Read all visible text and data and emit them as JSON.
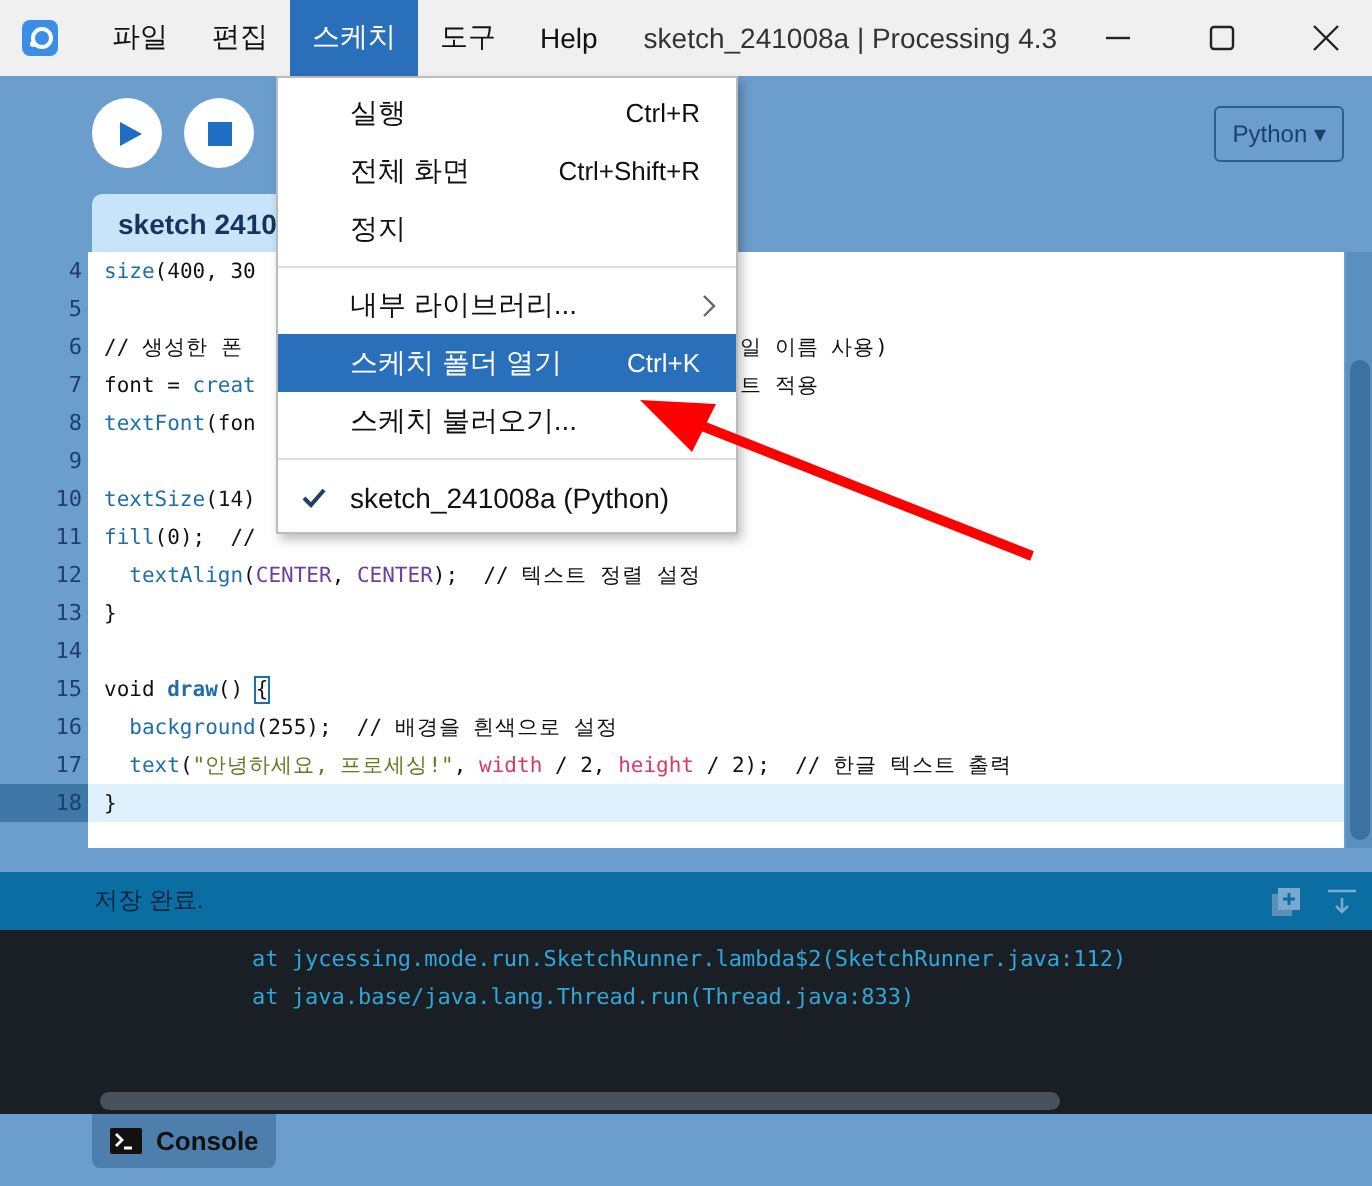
{
  "menubar": [
    {
      "label": "파일",
      "selected": false
    },
    {
      "label": "편집",
      "selected": false
    },
    {
      "label": "스케치",
      "selected": true
    },
    {
      "label": "도구",
      "selected": false
    },
    {
      "label": "Help",
      "selected": false
    }
  ],
  "window": {
    "title": "sketch_241008a | Processing 4.3"
  },
  "mode_selector": {
    "label": "Python ▾"
  },
  "tab": {
    "label": "sketch 2410"
  },
  "code_lines": [
    {
      "number": "4",
      "current": false,
      "tokens": [
        {
          "kind": "fn",
          "text": "size"
        },
        {
          "kind": "plain",
          "text": "(400, 30"
        }
      ]
    },
    {
      "number": "5",
      "current": false
    },
    {
      "number": "6",
      "current": false,
      "tokens": [
        {
          "kind": "plain",
          "text": "// 생성한 폰"
        }
      ],
      "tail": "일 이름 사용)"
    },
    {
      "number": "7",
      "current": false,
      "tokens": [
        {
          "kind": "plain",
          "text": "font = "
        },
        {
          "kind": "fn",
          "text": "creat"
        }
      ],
      "tail": "트 적용"
    },
    {
      "number": "8",
      "current": false,
      "tokens": [
        {
          "kind": "fn",
          "text": "textFont"
        },
        {
          "kind": "plain",
          "text": "(fon"
        }
      ]
    },
    {
      "number": "9",
      "current": false
    },
    {
      "number": "10",
      "current": false,
      "tokens": [
        {
          "kind": "fn",
          "text": "textSize"
        },
        {
          "kind": "plain",
          "text": "(14)"
        }
      ]
    },
    {
      "number": "11",
      "current": false,
      "tokens": [
        {
          "kind": "fn",
          "text": "fill"
        },
        {
          "kind": "plain",
          "text": "(0);  //"
        }
      ]
    },
    {
      "number": "12",
      "current": false,
      "tokens": [
        {
          "kind": "fn",
          "text": "  textAlign"
        },
        {
          "kind": "plain",
          "text": "("
        },
        {
          "kind": "const",
          "text": "CENTER"
        },
        {
          "kind": "plain",
          "text": ", "
        },
        {
          "kind": "const",
          "text": "CENTER"
        },
        {
          "kind": "plain",
          "text": ");  // 텍스트 정렬 설정"
        }
      ]
    },
    {
      "number": "13",
      "current": false,
      "tokens": [
        {
          "kind": "plain",
          "text": "}"
        }
      ]
    },
    {
      "number": "14",
      "current": false
    },
    {
      "number": "15",
      "current": false,
      "tokens": [
        {
          "kind": "plain",
          "text": "void "
        },
        {
          "kind": "fnbold",
          "text": "draw"
        },
        {
          "kind": "plain",
          "text": "() "
        },
        {
          "kind": "match",
          "text": "{"
        }
      ]
    },
    {
      "number": "16",
      "current": false,
      "tokens": [
        {
          "kind": "fn",
          "text": "  background"
        },
        {
          "kind": "plain",
          "text": "(255);  // 배경을 흰색으로 설정"
        }
      ]
    },
    {
      "number": "17",
      "current": false,
      "tokens": [
        {
          "kind": "fn",
          "text": "  text"
        },
        {
          "kind": "plain",
          "text": "("
        },
        {
          "kind": "string",
          "text": "\"안녕하세요, 프로세싱!\""
        },
        {
          "kind": "plain",
          "text": ", "
        },
        {
          "kind": "var",
          "text": "width"
        },
        {
          "kind": "plain",
          "text": " / 2, "
        },
        {
          "kind": "var",
          "text": "height"
        },
        {
          "kind": "plain",
          "text": " / 2);  // 한글 텍스트 출력"
        }
      ]
    },
    {
      "number": "18",
      "current": true,
      "tokens": [
        {
          "kind": "plain",
          "text": "}"
        }
      ]
    }
  ],
  "dropdown_menu": [
    {
      "kind": "item",
      "label": "실행",
      "shortcut": "Ctrl+R",
      "selected": false
    },
    {
      "kind": "item",
      "label": "전체 화면",
      "shortcut": "Ctrl+Shift+R",
      "selected": false
    },
    {
      "kind": "item",
      "label": "정지",
      "selected": false
    },
    {
      "kind": "separator"
    },
    {
      "kind": "submenu",
      "label": "내부 라이브러리...",
      "selected": false
    },
    {
      "kind": "item",
      "label": "스케치 폴더 열기",
      "shortcut": "Ctrl+K",
      "selected": true
    },
    {
      "kind": "item",
      "label": "스케치 불러오기...",
      "selected": false
    },
    {
      "kind": "separator"
    },
    {
      "kind": "check",
      "label": "sketch_241008a (Python)",
      "checked": true,
      "selected": false
    }
  ],
  "status_bar": {
    "message": "저장 완료."
  },
  "console_lines": [
    "at jycessing.mode.run.SketchRunner.lambda$2(SketchRunner.java:112)",
    "at java.base/java.lang.Thread.run(Thread.java:833)"
  ],
  "console_tab": {
    "label": "Console"
  }
}
